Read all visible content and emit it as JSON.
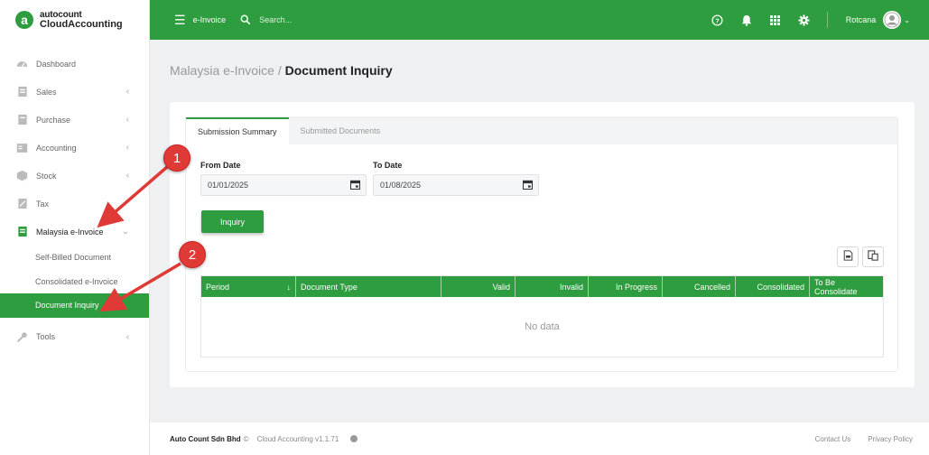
{
  "brand": {
    "mark": "a",
    "name": "autocount",
    "product": "CloudAccounting"
  },
  "topbar": {
    "module": "e-Invoice",
    "search_placeholder": "Search...",
    "username": "Rotcana"
  },
  "sidebar": {
    "items": [
      {
        "label": "Dashboard",
        "icon": "dashboard-icon"
      },
      {
        "label": "Sales",
        "icon": "sales-icon"
      },
      {
        "label": "Purchase",
        "icon": "purchase-icon"
      },
      {
        "label": "Accounting",
        "icon": "accounting-icon"
      },
      {
        "label": "Stock",
        "icon": "stock-icon"
      },
      {
        "label": "Tax",
        "icon": "tax-icon"
      },
      {
        "label": "Malaysia e-Invoice",
        "icon": "einvoice-icon"
      },
      {
        "label": "Tools",
        "icon": "tools-icon"
      }
    ],
    "subitems": [
      {
        "label": "Self-Billed Document"
      },
      {
        "label": "Consolidated e-Invoice"
      },
      {
        "label": "Document Inquiry"
      }
    ]
  },
  "breadcrumb": {
    "parent": "Malaysia e-Invoice",
    "separator": "/",
    "current": "Document Inquiry"
  },
  "tabs": [
    {
      "label": "Submission Summary"
    },
    {
      "label": "Submitted Documents"
    }
  ],
  "form": {
    "from_label": "From Date",
    "from_value": "01/01/2025",
    "to_label": "To Date",
    "to_value": "01/08/2025",
    "inquiry_button": "Inquiry"
  },
  "grid": {
    "columns": [
      "Period",
      "Document Type",
      "Valid",
      "Invalid",
      "In Progress",
      "Cancelled",
      "Consolidated",
      "To Be Consolidate"
    ],
    "sort_indicator": "↓",
    "empty_text": "No data"
  },
  "annotations": {
    "step1": "1",
    "step2": "2"
  },
  "footer": {
    "company": "Auto Count Sdn Bhd",
    "copyright": "©",
    "version": "Cloud Accounting v1.1.71",
    "contact": "Contact Us",
    "privacy": "Privacy Policy"
  },
  "colors": {
    "primary": "#2e9d3f",
    "annotation": "#e03a36"
  }
}
